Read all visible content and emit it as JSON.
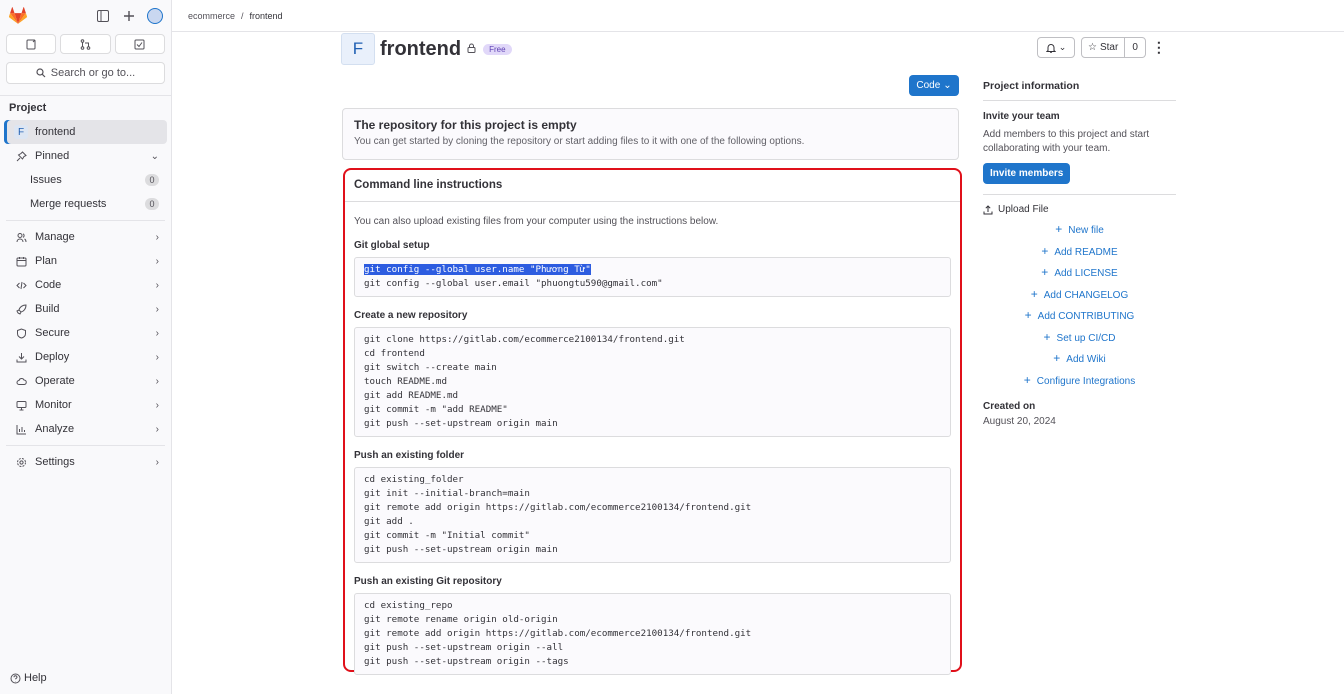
{
  "breadcrumb": {
    "group": "ecommerce",
    "separator": "/",
    "project": "frontend"
  },
  "sidebar": {
    "search_label": "Search or go to...",
    "section_title": "Project",
    "project_item": {
      "letter": "F",
      "label": "frontend"
    },
    "pinned_label": "Pinned",
    "pinned_items": [
      {
        "label": "Issues",
        "count": "0"
      },
      {
        "label": "Merge requests",
        "count": "0"
      }
    ],
    "nav_items": [
      {
        "label": "Manage",
        "icon": "users-icon"
      },
      {
        "label": "Plan",
        "icon": "calendar-icon"
      },
      {
        "label": "Code",
        "icon": "code-icon"
      },
      {
        "label": "Build",
        "icon": "rocket-icon"
      },
      {
        "label": "Secure",
        "icon": "shield-icon"
      },
      {
        "label": "Deploy",
        "icon": "deploy-icon"
      },
      {
        "label": "Operate",
        "icon": "cloud-icon"
      },
      {
        "label": "Monitor",
        "icon": "monitor-icon"
      },
      {
        "label": "Analyze",
        "icon": "chart-icon"
      }
    ],
    "settings_label": "Settings",
    "help_label": "Help"
  },
  "project": {
    "avatar_letter": "F",
    "title": "frontend",
    "badge": "Free",
    "star_label": "Star",
    "star_count": "0",
    "code_button": "Code"
  },
  "empty_repo": {
    "title": "The repository for this project is empty",
    "text": "You can get started by cloning the repository or start adding files to it with one of the following options."
  },
  "cli": {
    "title": "Command line instructions",
    "intro": "You can also upload existing files from your computer using the instructions below.",
    "global_setup_title": "Git global setup",
    "global_setup_line1": "git config --global user.name \"Phương Từ\"",
    "global_setup_line2": "git config --global user.email \"phuongtu590@gmail.com\"",
    "new_repo_title": "Create a new repository",
    "new_repo_code": "git clone https://gitlab.com/ecommerce2100134/frontend.git\ncd frontend\ngit switch --create main\ntouch README.md\ngit add README.md\ngit commit -m \"add README\"\ngit push --set-upstream origin main",
    "existing_folder_title": "Push an existing folder",
    "existing_folder_code": "cd existing_folder\ngit init --initial-branch=main\ngit remote add origin https://gitlab.com/ecommerce2100134/frontend.git\ngit add .\ngit commit -m \"Initial commit\"\ngit push --set-upstream origin main",
    "existing_repo_title": "Push an existing Git repository",
    "existing_repo_code": "cd existing_repo\ngit remote rename origin old-origin\ngit remote add origin https://gitlab.com/ecommerce2100134/frontend.git\ngit push --set-upstream origin --all\ngit push --set-upstream origin --tags"
  },
  "right_panel": {
    "title": "Project information",
    "invite_title": "Invite your team",
    "invite_text": "Add members to this project and start collaborating with your team.",
    "invite_button": "Invite members",
    "upload_label": "Upload File",
    "links": [
      "New file",
      "Add README",
      "Add LICENSE",
      "Add CHANGELOG",
      "Add CONTRIBUTING",
      "Set up CI/CD",
      "Add Wiki",
      "Configure Integrations"
    ],
    "created_label": "Created on",
    "created_value": "August 20, 2024"
  },
  "colors": {
    "accent": "#1f75cb",
    "highlight_border": "#e0101a",
    "brand_orange": "#fc6d26"
  }
}
